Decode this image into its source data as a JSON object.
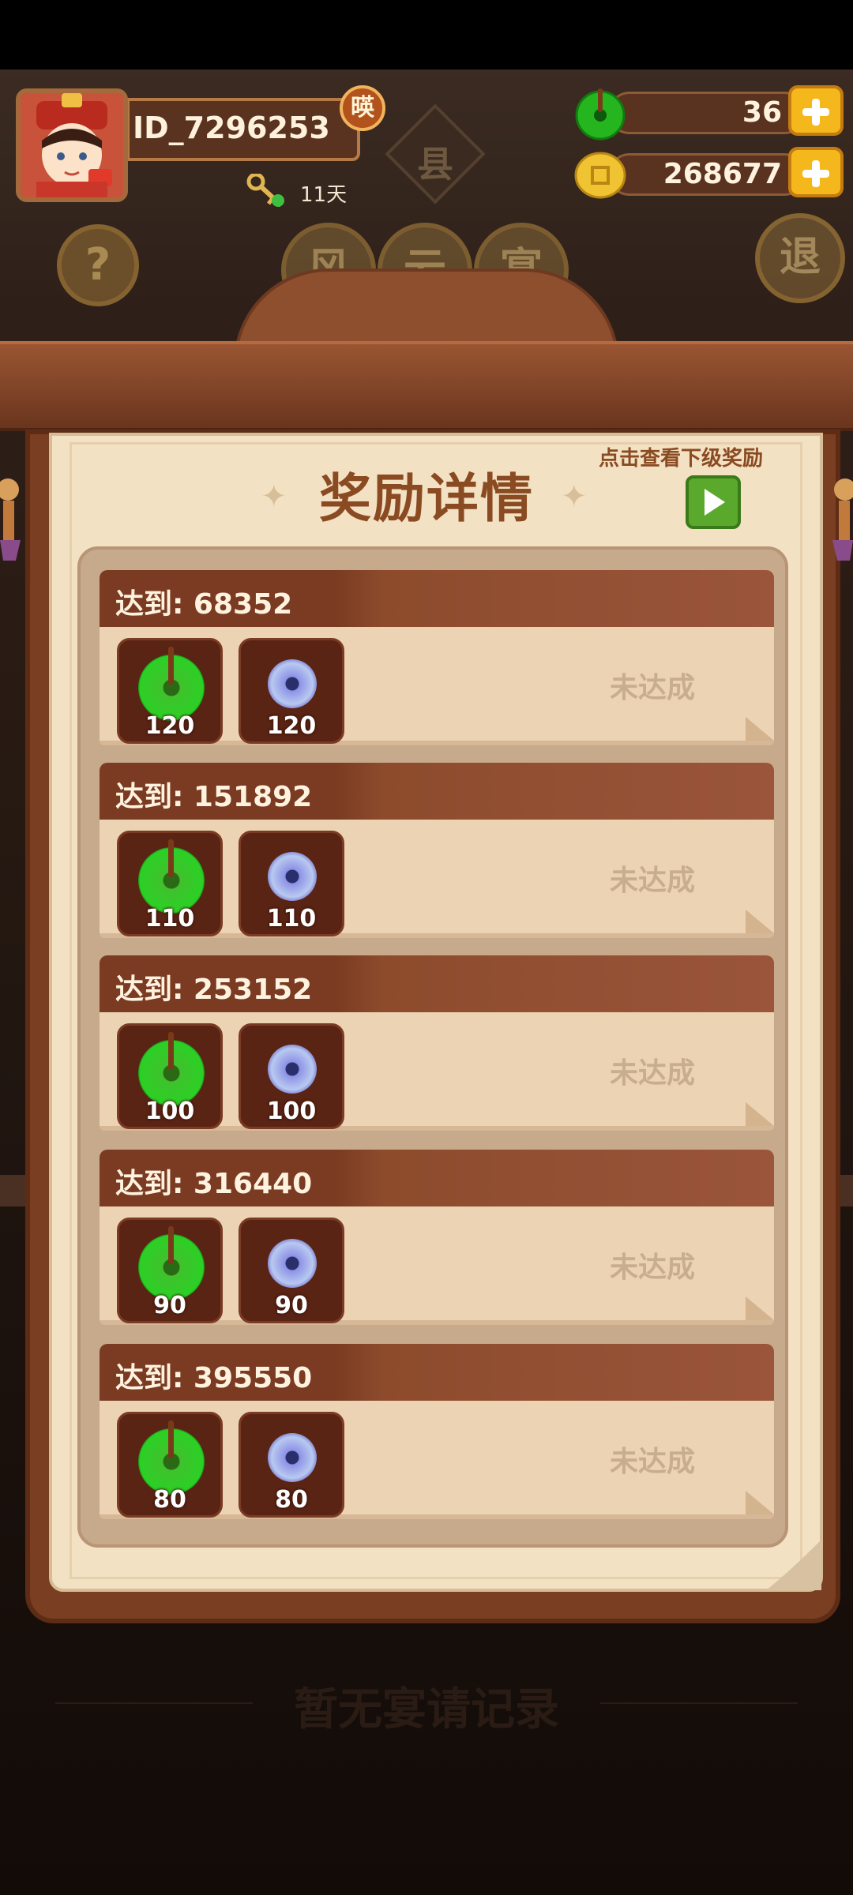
{
  "player": {
    "id": "ID_7296253",
    "county_badge": "暎",
    "days": "11天"
  },
  "currencies": [
    {
      "name": "jade",
      "icon": "green-jade-icon",
      "value": "36"
    },
    {
      "name": "coin",
      "icon": "gold-coin-icon",
      "value": "268677"
    }
  ],
  "background": {
    "help": "?",
    "exit": "退",
    "tabs": [
      "风",
      "云",
      "宴"
    ],
    "county": "县",
    "empty_record": "暂无宴请记录"
  },
  "panel": {
    "title": "奖励详情",
    "hint": "点击查看下级奖励"
  },
  "rewards": [
    {
      "label": "达到: 68352",
      "jade": "120",
      "disc": "120",
      "status": "未达成"
    },
    {
      "label": "达到: 151892",
      "jade": "110",
      "disc": "110",
      "status": "未达成"
    },
    {
      "label": "达到: 253152",
      "jade": "100",
      "disc": "100",
      "status": "未达成"
    },
    {
      "label": "达到: 316440",
      "jade": "90",
      "disc": "90",
      "status": "未达成"
    },
    {
      "label": "达到: 395550",
      "jade": "80",
      "disc": "80",
      "status": "未达成"
    }
  ],
  "colors": {
    "accent_brown": "#8a4b22",
    "card_header": "#7a3b22",
    "paper": "#f3e1c4",
    "plus_button": "#f5b81c",
    "play_button": "#5ba92c"
  }
}
